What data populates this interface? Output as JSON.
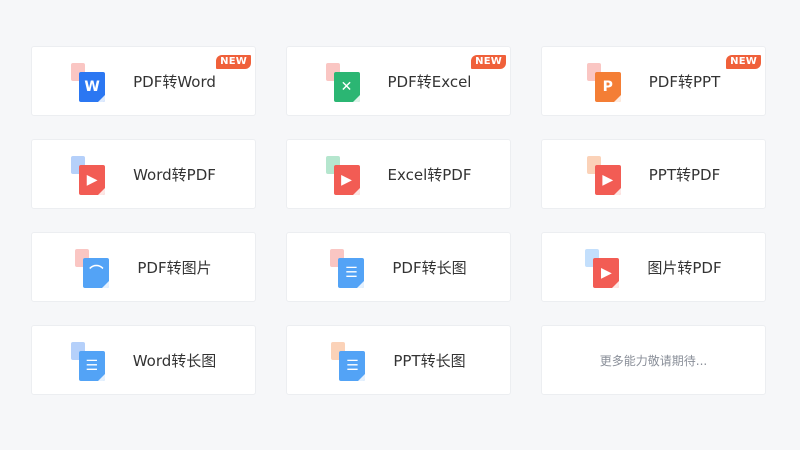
{
  "colors": {
    "pdf": "#f25c54",
    "word": "#2b77f2",
    "excel": "#2bb673",
    "ppt": "#f47e35",
    "image": "#53a3f6",
    "badge": "#f0603a"
  },
  "cards": [
    {
      "label": "PDF转Word",
      "badge": "NEW",
      "icon": {
        "from": "pdf",
        "to": "word",
        "glyph": "W",
        "name": "word-file-icon"
      }
    },
    {
      "label": "PDF转Excel",
      "badge": "NEW",
      "icon": {
        "from": "pdf",
        "to": "excel",
        "glyph": "✕",
        "name": "excel-file-icon"
      }
    },
    {
      "label": "PDF转PPT",
      "badge": "NEW",
      "icon": {
        "from": "pdf",
        "to": "ppt",
        "glyph": "P",
        "name": "ppt-file-icon"
      }
    },
    {
      "label": "Word转PDF",
      "badge": "",
      "icon": {
        "from": "word",
        "to": "pdf",
        "glyph": "▶",
        "name": "pdf-file-icon"
      }
    },
    {
      "label": "Excel转PDF",
      "badge": "",
      "icon": {
        "from": "excel",
        "to": "pdf",
        "glyph": "▶",
        "name": "pdf-file-icon"
      }
    },
    {
      "label": "PPT转PDF",
      "badge": "",
      "icon": {
        "from": "ppt",
        "to": "pdf",
        "glyph": "▶",
        "name": "pdf-file-icon"
      }
    },
    {
      "label": "PDF转图片",
      "badge": "",
      "icon": {
        "from": "pdf",
        "to": "image",
        "glyph": "⌒",
        "name": "image-file-icon"
      }
    },
    {
      "label": "PDF转长图",
      "badge": "",
      "icon": {
        "from": "pdf",
        "to": "image",
        "glyph": "☰",
        "name": "long-image-file-icon"
      }
    },
    {
      "label": "图片转PDF",
      "badge": "",
      "icon": {
        "from": "image",
        "to": "pdf",
        "glyph": "▶",
        "name": "pdf-file-icon"
      }
    },
    {
      "label": "Word转长图",
      "badge": "",
      "icon": {
        "from": "word",
        "to": "image",
        "glyph": "☰",
        "name": "long-image-file-icon"
      }
    },
    {
      "label": "PPT转长图",
      "badge": "",
      "icon": {
        "from": "ppt",
        "to": "image",
        "glyph": "☰",
        "name": "long-image-file-icon"
      }
    }
  ],
  "more": {
    "label": "更多能力敬请期待..."
  }
}
